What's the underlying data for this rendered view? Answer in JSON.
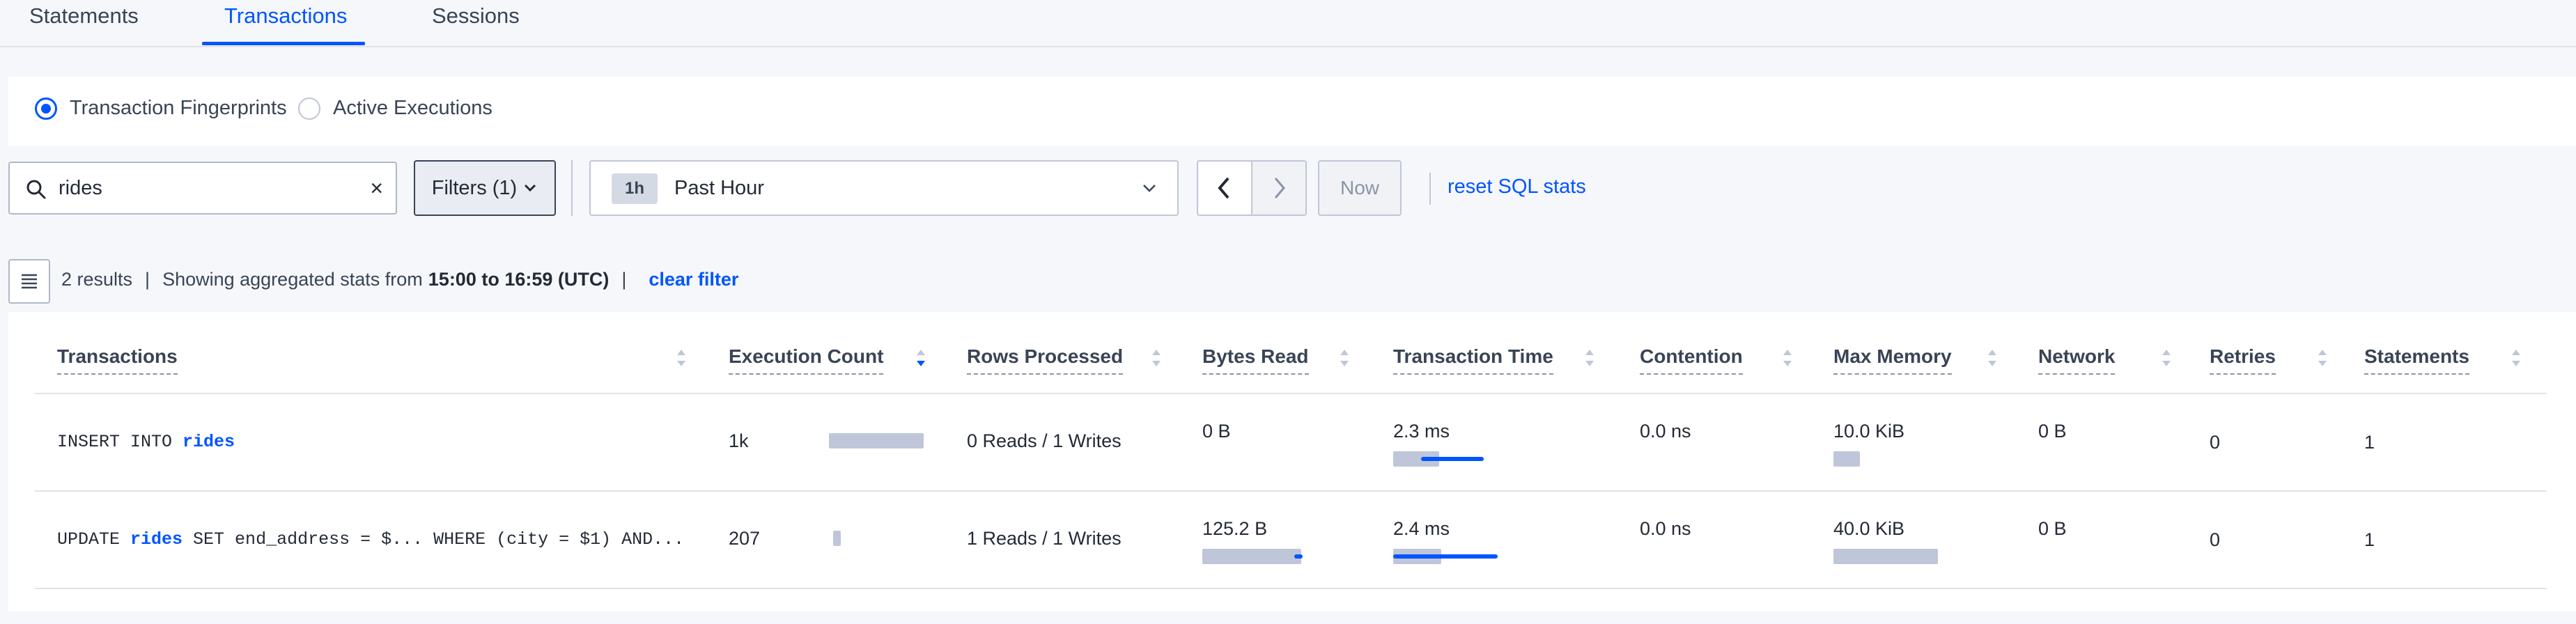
{
  "tabs": [
    {
      "label": "Statements",
      "active": false
    },
    {
      "label": "Transactions",
      "active": true
    },
    {
      "label": "Sessions",
      "active": false
    }
  ],
  "view_mode": {
    "options": [
      {
        "label": "Transaction Fingerprints",
        "selected": true
      },
      {
        "label": "Active Executions",
        "selected": false
      }
    ]
  },
  "search": {
    "value": "rides",
    "clear": "×"
  },
  "filters": {
    "label": "Filters (1)"
  },
  "time": {
    "badge": "1h",
    "label": "Past Hour",
    "now_label": "Now"
  },
  "reset_link": "reset SQL stats",
  "summary": {
    "results": "2 results",
    "showing": "Showing aggregated stats from",
    "range": "15:00 to 16:59 (UTC)",
    "clear_filter": "clear filter"
  },
  "table": {
    "columns": [
      "Transactions",
      "Execution Count",
      "Rows Processed",
      "Bytes Read",
      "Transaction Time",
      "Contention",
      "Max Memory",
      "Network",
      "Retries",
      "Statements"
    ],
    "rows": [
      {
        "sql_pre": "INSERT INTO ",
        "sql_kw": "rides",
        "sql_post": "",
        "exec_count": "1k",
        "exec_bar": 1.0,
        "rows_processed": "0 Reads / 1 Writes",
        "bytes_read": "0 B",
        "bytes_bar": 0,
        "tx_time": "2.3 ms",
        "tx_bar": 0.44,
        "tx_line": 0.6,
        "contention": "0.0 ns",
        "max_memory": "10.0 KiB",
        "mem_bar": 0.25,
        "network": "0 B",
        "retries": "0",
        "statements": "1"
      },
      {
        "sql_pre": "UPDATE ",
        "sql_kw": "rides",
        "sql_post": " SET end_address = $... WHERE (city = $1) AND...",
        "exec_count": "207",
        "exec_bar": 0.2,
        "rows_processed": "1 Reads / 1 Writes",
        "bytes_read": "125.2 B",
        "bytes_bar": 1.0,
        "tx_time": "2.4 ms",
        "tx_bar": 0.46,
        "tx_line": 1.0,
        "contention": "0.0 ns",
        "max_memory": "40.0 KiB",
        "mem_bar": 1.0,
        "network": "0 B",
        "retries": "0",
        "statements": "1"
      }
    ]
  },
  "colors": {
    "accent": "#0055ff",
    "bar": "#c0c6d9",
    "text": "#394455"
  }
}
